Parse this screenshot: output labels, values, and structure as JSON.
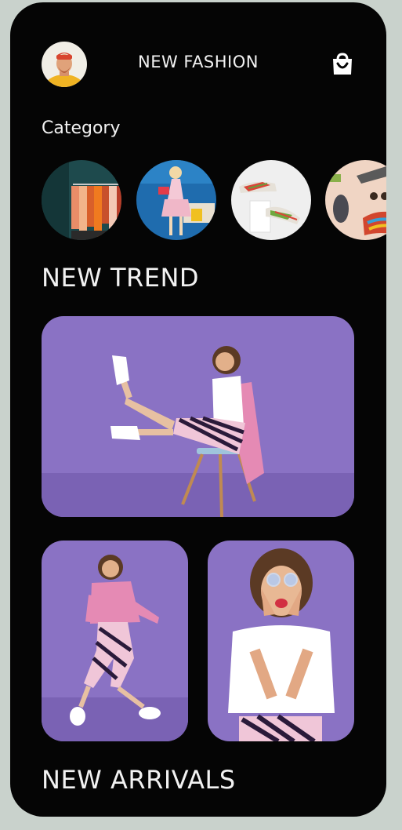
{
  "header": {
    "title": "NEW FASHION",
    "avatar_icon": "user-avatar",
    "bag_icon": "shopping-bag-icon"
  },
  "category": {
    "label": "Category",
    "items": [
      {
        "name": "clothing-rack",
        "icon": "clothes-rack-photo"
      },
      {
        "name": "dress-model",
        "icon": "model-photo"
      },
      {
        "name": "sneakers",
        "icon": "shoes-photo"
      },
      {
        "name": "accessories",
        "icon": "accessories-photo"
      }
    ]
  },
  "trend": {
    "heading": "NEW TREND"
  },
  "arrivals": {
    "heading": "NEW ARRIVALS"
  },
  "colors": {
    "background": "#050505",
    "page": "#c9d2cc",
    "purple": "#8a72c4",
    "text": "#f2f2f2"
  }
}
